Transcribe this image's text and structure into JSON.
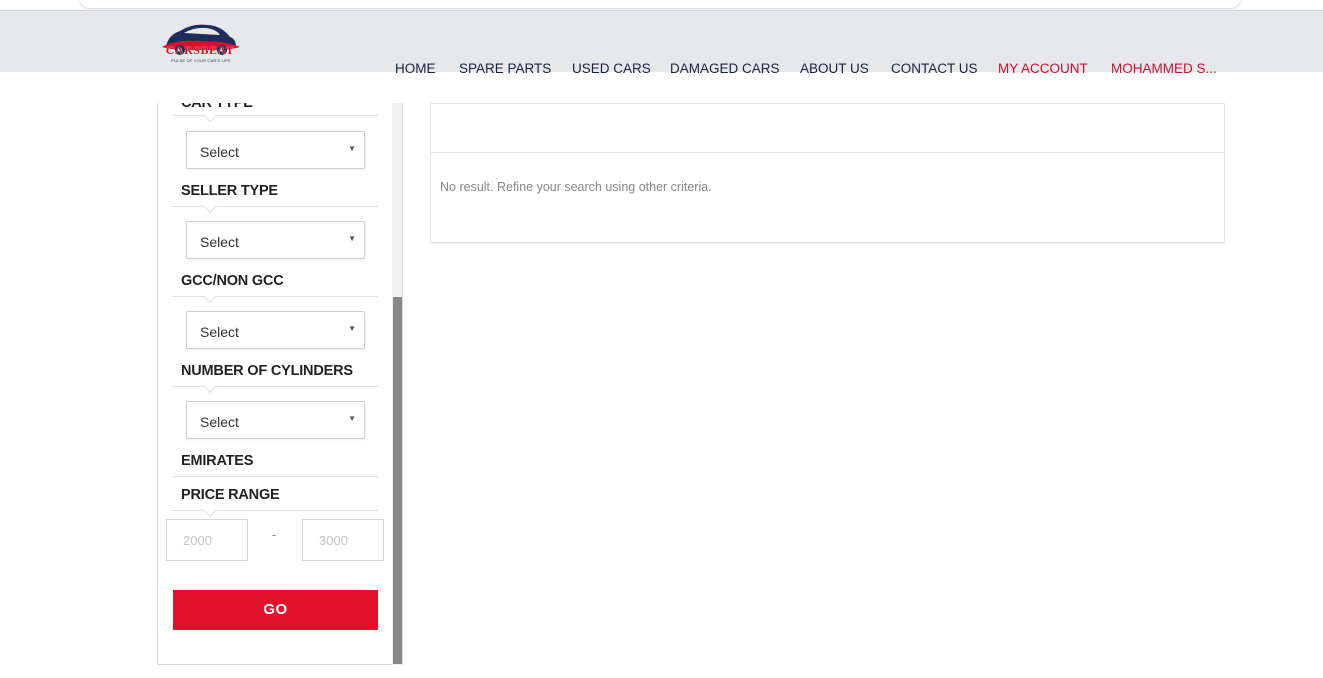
{
  "brand": {
    "name": "CARSBEAT",
    "tagline": "PULSE OF YOUR CAR'S LIFE",
    "primary_color": "#d8102e",
    "navy_color": "#1c2c5c"
  },
  "nav": {
    "home": "HOME",
    "spare_parts": "SPARE PARTS",
    "used_cars": "USED CARS",
    "damaged_cars": "DAMAGED CARS",
    "about_us": "ABOUT US",
    "contact_us": "CONTACT US",
    "my_account": "MY ACCOUNT",
    "user": "MOHAMMED S..."
  },
  "filters": {
    "car_type": {
      "title": "CAR TYPE",
      "value": "Select"
    },
    "seller_type": {
      "title": "SELLER TYPE",
      "value": "Select"
    },
    "gcc": {
      "title": "GCC/NON GCC",
      "value": "Select"
    },
    "cylinders": {
      "title": "NUMBER OF CYLINDERS",
      "value": "Select"
    },
    "emirates": {
      "title": "EMIRATES"
    },
    "price_range": {
      "title": "PRICE RANGE",
      "min_placeholder": "2000",
      "max_placeholder": "3000",
      "separator": "-"
    },
    "go_label": "GO"
  },
  "results": {
    "message": "No result. Refine your search using other criteria."
  }
}
